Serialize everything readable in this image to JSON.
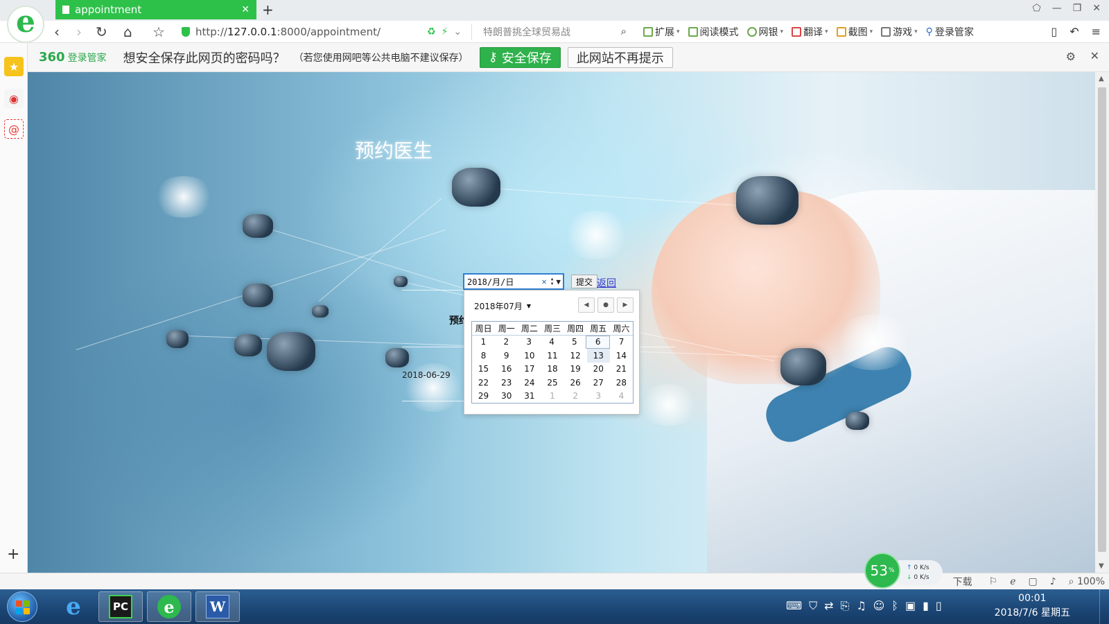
{
  "browser": {
    "tab": {
      "title": "appointment",
      "close": "✕",
      "new_tab": "+"
    },
    "window_controls": [
      "⬠",
      "—",
      "❐",
      "✕"
    ],
    "nav": {
      "back": "‹",
      "forward": "›",
      "reload": "↻",
      "home": "⌂",
      "favorite": "☆"
    },
    "address": {
      "scheme": "http://",
      "host": "127.0.0.1",
      "rest": ":8000/appointment/"
    },
    "search": {
      "placeholder": "特朗普挑全球贸易战"
    },
    "extensions": [
      {
        "label": "扩展",
        "dropdown": true
      },
      {
        "label": "阅读模式",
        "dropdown": false
      },
      {
        "label": "网银",
        "dropdown": true
      },
      {
        "label": "翻译",
        "dropdown": true
      },
      {
        "label": "截图",
        "dropdown": true
      },
      {
        "label": "游戏",
        "dropdown": true
      },
      {
        "label": "登录管家",
        "dropdown": false
      }
    ]
  },
  "password_bar": {
    "brand": "360",
    "brand_sub": "登录管家",
    "question": "想安全保存此网页的密码吗？",
    "note": "（若您使用网吧等公共电脑不建议保存）",
    "save_label": "安全保存",
    "never_label": "此网站不再提示"
  },
  "page": {
    "title": "预约医生",
    "date_input": {
      "value": "2018/月/日",
      "clear": "✕"
    },
    "submit_label": "提交",
    "back_label": "返回",
    "partial_heading": "预约",
    "existing_date": "2018-06-29"
  },
  "calendar": {
    "header": "2018年07月",
    "weekdays": [
      "周日",
      "周一",
      "周二",
      "周三",
      "周四",
      "周五",
      "周六"
    ],
    "weeks": [
      [
        "1",
        "2",
        "3",
        "4",
        "5",
        "6",
        "7"
      ],
      [
        "8",
        "9",
        "10",
        "11",
        "12",
        "13",
        "14"
      ],
      [
        "15",
        "16",
        "17",
        "18",
        "19",
        "20",
        "21"
      ],
      [
        "22",
        "23",
        "24",
        "25",
        "26",
        "27",
        "28"
      ],
      [
        "29",
        "30",
        "31",
        "1",
        "2",
        "3",
        "4"
      ]
    ],
    "selected_day": "6",
    "today_day": "13"
  },
  "status_bar": {
    "download": "下载",
    "zoom": "100%"
  },
  "perf": {
    "percent": "53",
    "unit": "%",
    "up": "0 K/s",
    "down": "0 K/s"
  },
  "taskbar": {
    "time": "00:01",
    "date": "2018/7/6 星期五"
  }
}
